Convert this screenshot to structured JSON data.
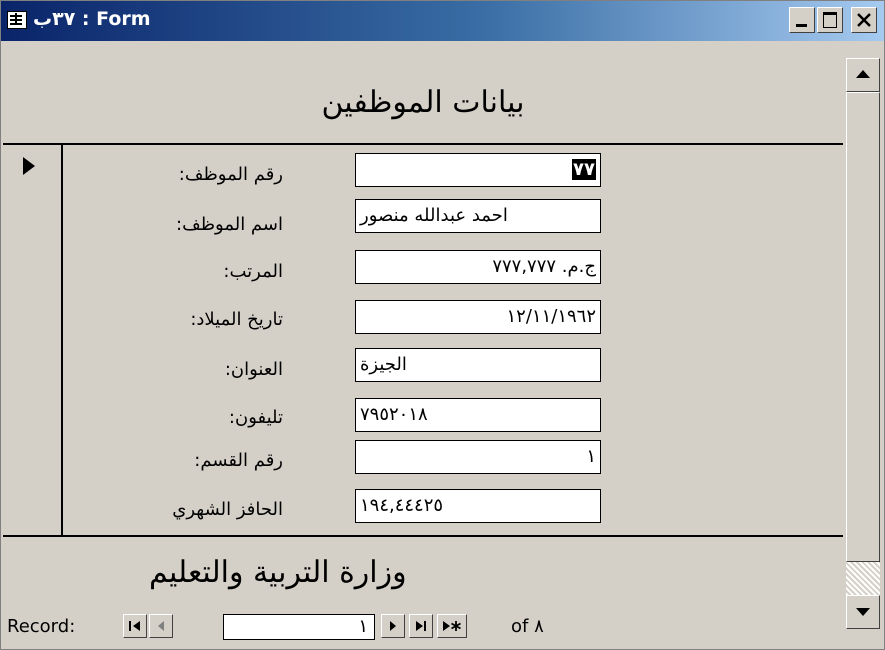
{
  "window": {
    "title": "٣٧ب : Form"
  },
  "form": {
    "header": "بيانات الموظفين",
    "footer": "وزارة التربية والتعليم",
    "fields": [
      {
        "label": "رقم الموظف:",
        "value": "٧٧"
      },
      {
        "label": "اسم الموظف:",
        "value": "احمد عبدالله منصور"
      },
      {
        "label": "المرتب:",
        "value": "ج.م. ٧٧٧,٧٧٧"
      },
      {
        "label": "تاريخ الميلاد:",
        "value": "١٢/١١/١٩٦٢"
      },
      {
        "label": "العنوان:",
        "value": "الجيزة"
      },
      {
        "label": "تليفون:",
        "value": "٧٩٥٢٠١٨"
      },
      {
        "label": "رقم القسم:",
        "value": "١"
      },
      {
        "label": "الحافز الشهري",
        "value": "١٩٤,٤٤٤٢٥"
      }
    ]
  },
  "navigation": {
    "record_label": "Record:",
    "current_record": "١",
    "of_text": "of ٨"
  }
}
